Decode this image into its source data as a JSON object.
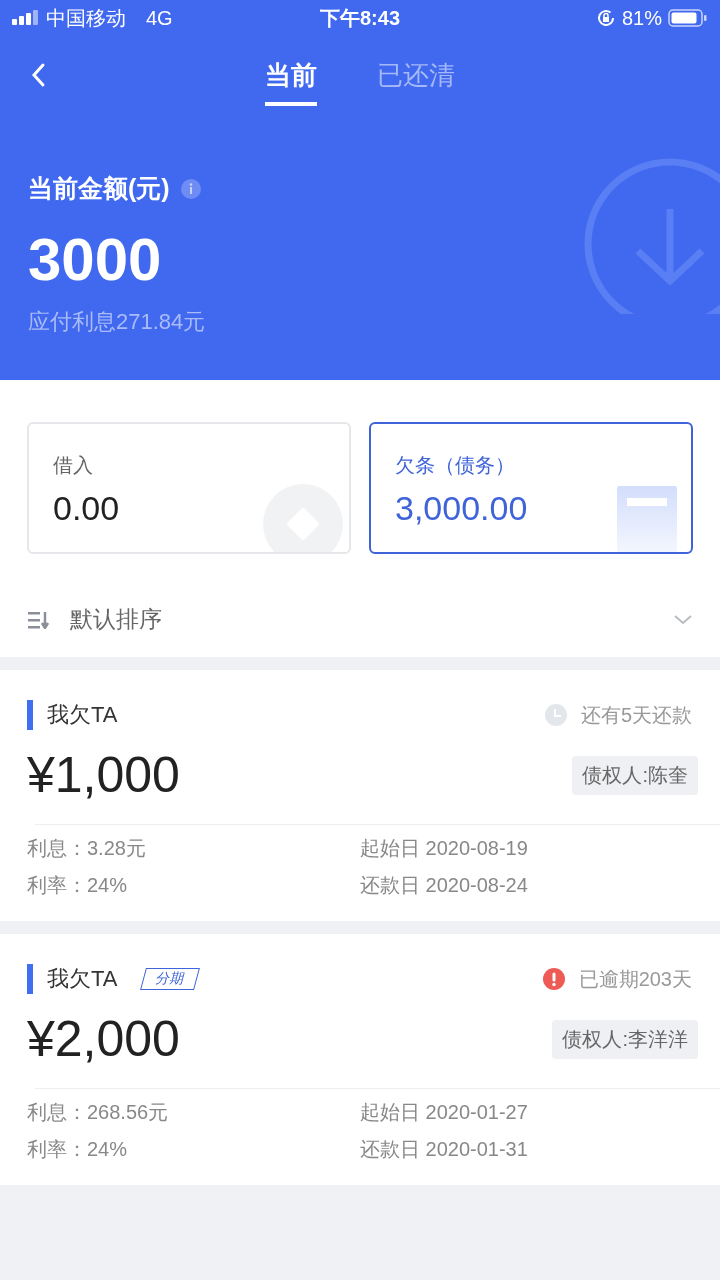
{
  "status_bar": {
    "carrier": "中国移动",
    "network": "4G",
    "time": "下午8:43",
    "battery": "81%"
  },
  "tabs": [
    {
      "label": "当前",
      "selected": true
    },
    {
      "label": "已还清",
      "selected": false
    }
  ],
  "summary": {
    "title": "当前金额(元)",
    "amount": "3000",
    "interest": "应付利息271.84元"
  },
  "cards": [
    {
      "kind": "borrow",
      "label": "借入",
      "value": "0.00",
      "selected": false
    },
    {
      "kind": "debt",
      "label": "欠条（债务）",
      "value": "3,000.00",
      "selected": true
    }
  ],
  "sort": {
    "label": "默认排序"
  },
  "loans": [
    {
      "title": "我欠TA",
      "kind": "due",
      "status": "还有5天还款",
      "amount": "¥1,000",
      "creditor": "债权人:陈奎",
      "interest": "利息：3.28元",
      "start": "起始日 2020-08-19",
      "rate": "利率：24%",
      "due": "还款日 2020-08-24"
    },
    {
      "title": "我欠TA",
      "tag": "分期",
      "kind": "overdue",
      "status": "已逾期203天",
      "amount": "¥2,000",
      "creditor": "债权人:李洋洋",
      "interest": "利息：268.56元",
      "start": "起始日 2020-01-27",
      "rate": "利率：24%",
      "due": "还款日 2020-01-31"
    }
  ]
}
